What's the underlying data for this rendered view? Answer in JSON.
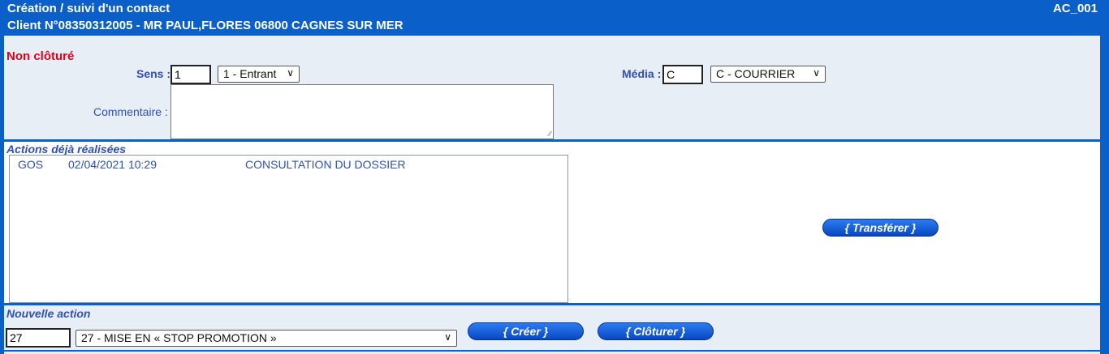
{
  "header": {
    "title": "Création / suivi d'un contact",
    "client": "Client N°08350312005 - MR PAUL,FLORES 06800 CAGNES SUR MER",
    "screen_code": "AC_001"
  },
  "contact": {
    "status": "Non clôturé",
    "sens_label": "Sens :",
    "sens_value": "1",
    "sens_selected": "1 - Entrant",
    "media_label": "Média :",
    "media_value": "C",
    "media_selected": "C - COURRIER",
    "comment_label": "Commentaire :",
    "comment_value": ""
  },
  "actions": {
    "title": "Actions déjà réalisées",
    "rows": [
      {
        "user": "GOS",
        "date": "02/04/2021 10:29",
        "label": "CONSULTATION DU DOSSIER"
      }
    ],
    "transfer_button": "{ Transférer }"
  },
  "new_action": {
    "title": "Nouvelle action",
    "code_value": "27",
    "selected": "27 - MISE EN « STOP PROMOTION »",
    "create_button": "{ Créer }",
    "close_button": "{ Clôturer }"
  },
  "colors": {
    "brand_blue": "#0a5fc8",
    "label_blue": "#2f50b8",
    "status_red": "#e0001a",
    "panel_bg": "#e8eef5"
  }
}
